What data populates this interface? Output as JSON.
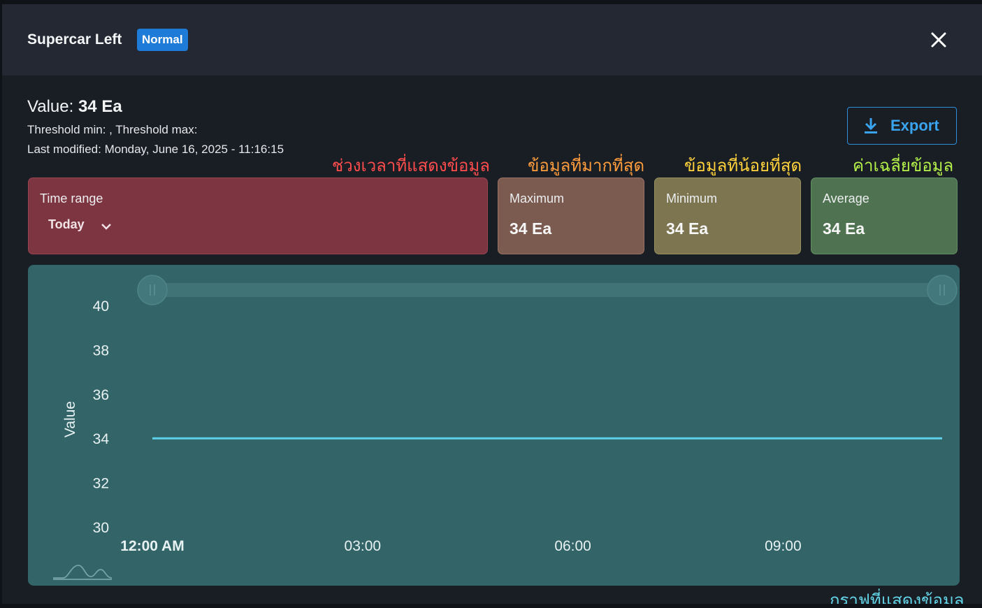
{
  "header": {
    "title": "Supercar Left",
    "status_badge": "Normal"
  },
  "summary": {
    "value_label": "Value:",
    "value": "34 Ea",
    "threshold_text": "Threshold min: , Threshold max:",
    "last_modified_label": "Last modified:",
    "last_modified": "Monday, June 16, 2025 - 11:16:15"
  },
  "toolbar": {
    "export_label": "Export",
    "export_icon": "download-icon"
  },
  "annotations": {
    "time_range": "ช่วงเวลาที่แสดงข้อมูล",
    "maximum": "ข้อมูลที่มากที่สุด",
    "minimum": "ข้อมูลที่น้อยที่สุด",
    "average": "ค่าเฉลี่ยข้อมูล",
    "graph": "กราฟที่แสดงข้อมูล"
  },
  "annotation_colors": {
    "time_range": "#ff4c4c",
    "maximum": "#ff9d3d",
    "minimum": "#ffd23b",
    "average": "#b3f04a",
    "graph": "#63d5e8"
  },
  "cards": {
    "time_range": {
      "label": "Time range",
      "selected": "Today"
    },
    "maximum": {
      "label": "Maximum",
      "value": "34 Ea"
    },
    "minimum": {
      "label": "Minimum",
      "value": "34 Ea"
    },
    "average": {
      "label": "Average",
      "value": "34 Ea"
    }
  },
  "chart_data": {
    "type": "line",
    "title": "",
    "ylabel": "Value",
    "xlabel": "",
    "ylim": [
      30,
      40
    ],
    "y_ticks": [
      40,
      38,
      36,
      34,
      32,
      30
    ],
    "x_ticks": [
      "12:00 AM",
      "03:00",
      "06:00",
      "09:00"
    ],
    "x_tick_hours": [
      0,
      3,
      6,
      9
    ],
    "x_range_hours": [
      0,
      11.27
    ],
    "series": [
      {
        "x_hours": [
          0,
          11.27
        ],
        "values": [
          34,
          34
        ]
      }
    ],
    "line_color": "#5ed0ea",
    "range_slider": "full",
    "grid": false
  }
}
